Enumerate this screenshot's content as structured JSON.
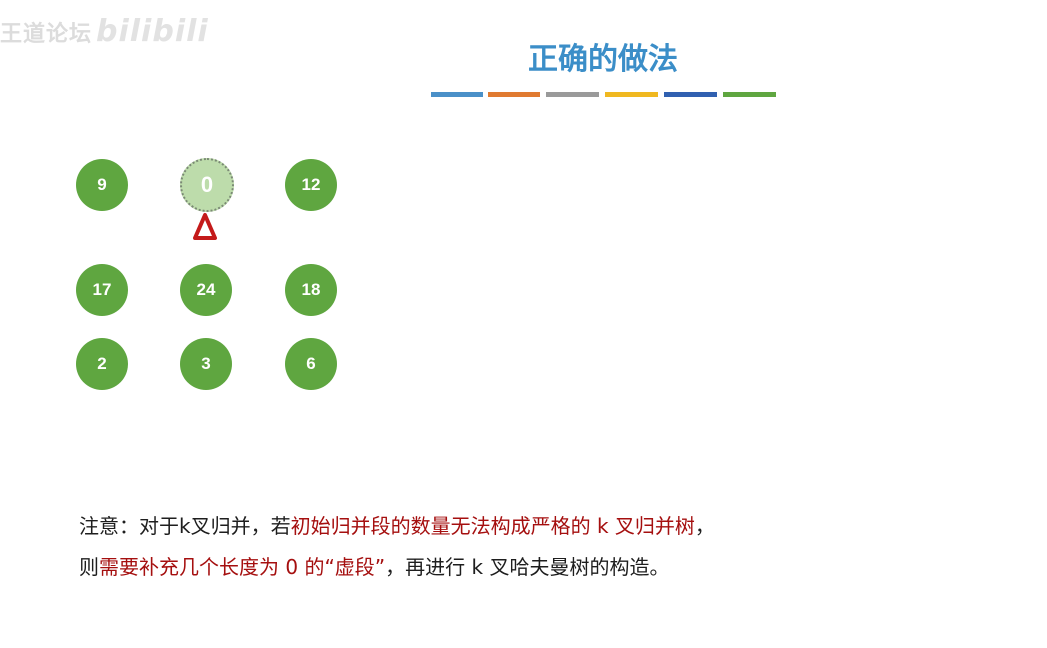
{
  "watermark": {
    "text": "王道论坛",
    "logo": "bilibili"
  },
  "title": "正确的做法",
  "color_bar": [
    "#4a90c8",
    "#e07a30",
    "#9a9a9a",
    "#f0b820",
    "#3060b0",
    "#5fa640"
  ],
  "nodes": {
    "n1": "9",
    "n2": "0",
    "n3": "12",
    "n4": "17",
    "n5": "24",
    "n6": "18",
    "n7": "2",
    "n8": "3",
    "n9": "6"
  },
  "note": {
    "line1_a": "注意：对于k叉归并，若",
    "line1_b": "初始归并段的数量无法构成严格的 k 叉归并树",
    "line1_c": "，",
    "line2_a": "则",
    "line2_b": "需要补充几个长度为 0 的“虚段”",
    "line2_c": "，再进行 k 叉哈夫曼树的构造。"
  }
}
